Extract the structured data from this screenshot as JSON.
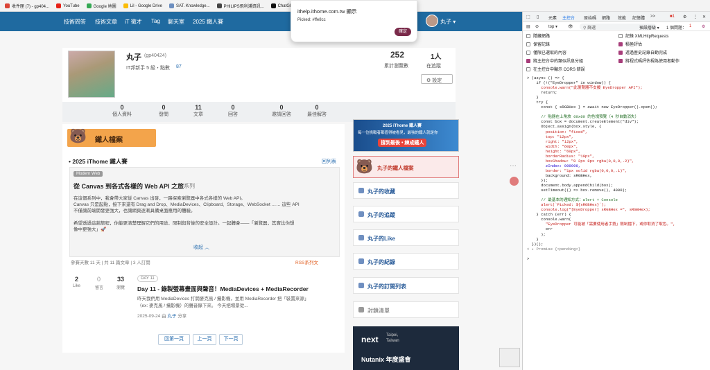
{
  "bookmarks": [
    "收件匣 (7) - gp404...",
    "YouTube",
    "Google 地圖",
    "Lil - Google Drive",
    "SAT. Knowledge...",
    "PHILIPS飛利浦資訊...",
    "ChatGPT",
    "Perplexity"
  ],
  "nav": {
    "items": [
      "技術問答",
      "技術文章",
      "iT 徵才",
      "Tag",
      "聊天室",
      "2025 鐵人賽"
    ],
    "user": "丸子 ▾"
  },
  "dialog": {
    "title": "ithelp.ithome.com.tw 顯示",
    "message": "Picked: #ffe8cc",
    "ok": "確定"
  },
  "profile": {
    "name": "丸子",
    "handle": "(gp40424)",
    "level": "IT邦新手 5 級・點數",
    "points": "87",
    "views": "252",
    "views_label": "累計瀏覽數",
    "following": "1人",
    "following_label": "在追蹤",
    "settings": "設定"
  },
  "stats": [
    {
      "v": "0",
      "l": "個人資料"
    },
    {
      "v": "0",
      "l": "發問"
    },
    {
      "v": "11",
      "l": "文章"
    },
    {
      "v": "0",
      "l": "回答"
    },
    {
      "v": "0",
      "l": "邀請回答"
    },
    {
      "v": "0",
      "l": "最佳解答"
    }
  ],
  "ironman": {
    "banner": "鐵人檔案",
    "section": "2025 iThome 鐵人賽",
    "back": "回列表",
    "tag": "Modern Web",
    "series_title": "從 Canvas 到各式各樣的 Web API 之旅",
    "series_suffix": "系列",
    "desc1": "在這個系列中，我會帶大家從 Canvas 出發，一路探索瀏覽器中各式各樣的 Web API。",
    "desc2": "Canvas 只是起點，接下來還有 Drag and Drop、MediaDevices、Clipboard、Storage、WebSocket …… 這些 API",
    "desc3": "不僅讓前端開發更強大，也讓網頁逐漸具備桌面應用的體驗。",
    "desc4": "希望透過這趟旅程，你能更清楚理解它們的用途、限制與背後的安全設計。一起體會——「瀏覽器，其實比你想",
    "desc5": "像中更強大」🚀",
    "collapse": "收起 ︿",
    "meta": "參賽天數 11 天 | 共 11 篇文章 | 3 人訂閱",
    "rss": "RSS系列文",
    "likes": "2",
    "likes_label": "Like",
    "comments": "0",
    "comments_label": "留言",
    "reads": "33",
    "reads_label": "瀏覽",
    "day": "DAY 11",
    "article_title": "Day 11 - 錄製螢幕畫面與聲音！MediaDevices + MediaRecorder",
    "article_desc1": "昨天我們用 MediaDevices 打開麥克風 / 攝影機，並用 MediaRecorder 把「裝置來源」",
    "article_desc2": "（ex: 麥克風 / 攝影機）的聲音錄下來。 今天把場景從...",
    "date": "2025-09-24",
    "by": "由",
    "author": "丸子",
    "share": "分享",
    "pg_first": "回第一頁",
    "pg_prev": "上一頁",
    "pg_next": "下一頁"
  },
  "sidebar": {
    "promo1": "2025 iThome 鐵人賽",
    "promo2": "每一位挑戰者都值得被看見，最強的鐵人就是你",
    "promo3": "撐到最後 • 練成鐵人",
    "iron_file": "丸子的鐵人檔案",
    "items": [
      "丸子的收藏",
      "丸子的追蹤",
      "丸子的Like",
      "丸子的紀錄",
      "丸子的訂閱列表",
      "封鎖清單"
    ],
    "ad_brand": "next",
    "ad_place1": "Taipei,",
    "ad_place2": "Taiwan",
    "ad_title": "Nutanix 年度盛會"
  },
  "devtools": {
    "tabs": [
      "元素",
      "主控台",
      "原始碼",
      "網路",
      "效能",
      "記憶體",
      ">>"
    ],
    "errors": "1",
    "context": "top",
    "filter_placeholder": "篩選",
    "levels": "預設層級 ▾",
    "issues": "1 個問題：",
    "issues_count": "1",
    "options_left": [
      {
        "label": "隱藏網路",
        "on": false
      },
      {
        "label": "保留記錄",
        "on": false
      },
      {
        "label": "僅限已選取的內容",
        "on": false
      },
      {
        "label": "將主控台中的類似訊息分組",
        "on": true
      },
      {
        "label": "在主控台中顯示 CORS 錯誤",
        "on": false
      }
    ],
    "options_right": [
      {
        "label": "記錄 XMLHttpRequests",
        "on": false
      },
      {
        "label": "積極評估",
        "on": true
      },
      {
        "label": "透過歷史記錄自動完成",
        "on": true
      },
      {
        "label": "將程式碼評估視為使用者動作",
        "on": true
      }
    ],
    "code": [
      [
        "> (async () => {",
        ""
      ],
      [
        "    if (!(\"EyeDropper\" in window)) {",
        ""
      ],
      [
        "      console.warn(\"此瀏覽器不支援 EyeDropper API\");",
        "s"
      ],
      [
        "      return;",
        ""
      ],
      [
        "    }",
        ""
      ],
      [
        "    try {",
        ""
      ],
      [
        "      const { sRGBHex } = await new EyeDropper().open();",
        ""
      ],
      [
        "",
        ""
      ],
      [
        "      // 貼器在上角放 60x60 的色塊預覽（4 秒自動消失）",
        "c"
      ],
      [
        "      const box = document.createElement(\"div\");",
        ""
      ],
      [
        "      Object.assign(box.style, {",
        ""
      ],
      [
        "        position: \"fixed\",",
        "s"
      ],
      [
        "        top: \"12px\",",
        "s"
      ],
      [
        "        right: \"12px\",",
        "s"
      ],
      [
        "        width: \"60px\",",
        "s"
      ],
      [
        "        height: \"60px\",",
        "s"
      ],
      [
        "        borderRadius: \"10px\",",
        "s"
      ],
      [
        "        boxShadow: \"0 2px 8px rgba(0,0,0,.2)\",",
        "s"
      ],
      [
        "        zIndex: 999999,",
        "n"
      ],
      [
        "        border: \"1px solid rgba(0,0,0,.1)\",",
        "s"
      ],
      [
        "        background: sRGBHex,",
        ""
      ],
      [
        "      });",
        ""
      ],
      [
        "      document.body.appendChild(box);",
        ""
      ],
      [
        "      setTimeout(() => box.remove(), 4000);",
        ""
      ],
      [
        "",
        ""
      ],
      [
        "      // 最基本的通知方式：alert + Console",
        "c"
      ],
      [
        "      alert(`Picked: ${sRGBHex}`);",
        "s"
      ],
      [
        "      console.log(\"[EyeDropper] sRGBHex =\", sRGBHex);",
        "s"
      ],
      [
        "    } catch (err) {",
        ""
      ],
      [
        "      console.warn(",
        ""
      ],
      [
        "        \"EyeDropper 可能被「需要使用者手勢」限制擋下，或你取消了取色。\",",
        "s"
      ],
      [
        "        err",
        ""
      ],
      [
        "      );",
        ""
      ],
      [
        "    }",
        ""
      ],
      [
        "  })();",
        ""
      ],
      [
        "< ▸ Promise {<pending>}",
        "g"
      ],
      [
        "",
        ""
      ],
      [
        ">",
        ""
      ]
    ]
  }
}
